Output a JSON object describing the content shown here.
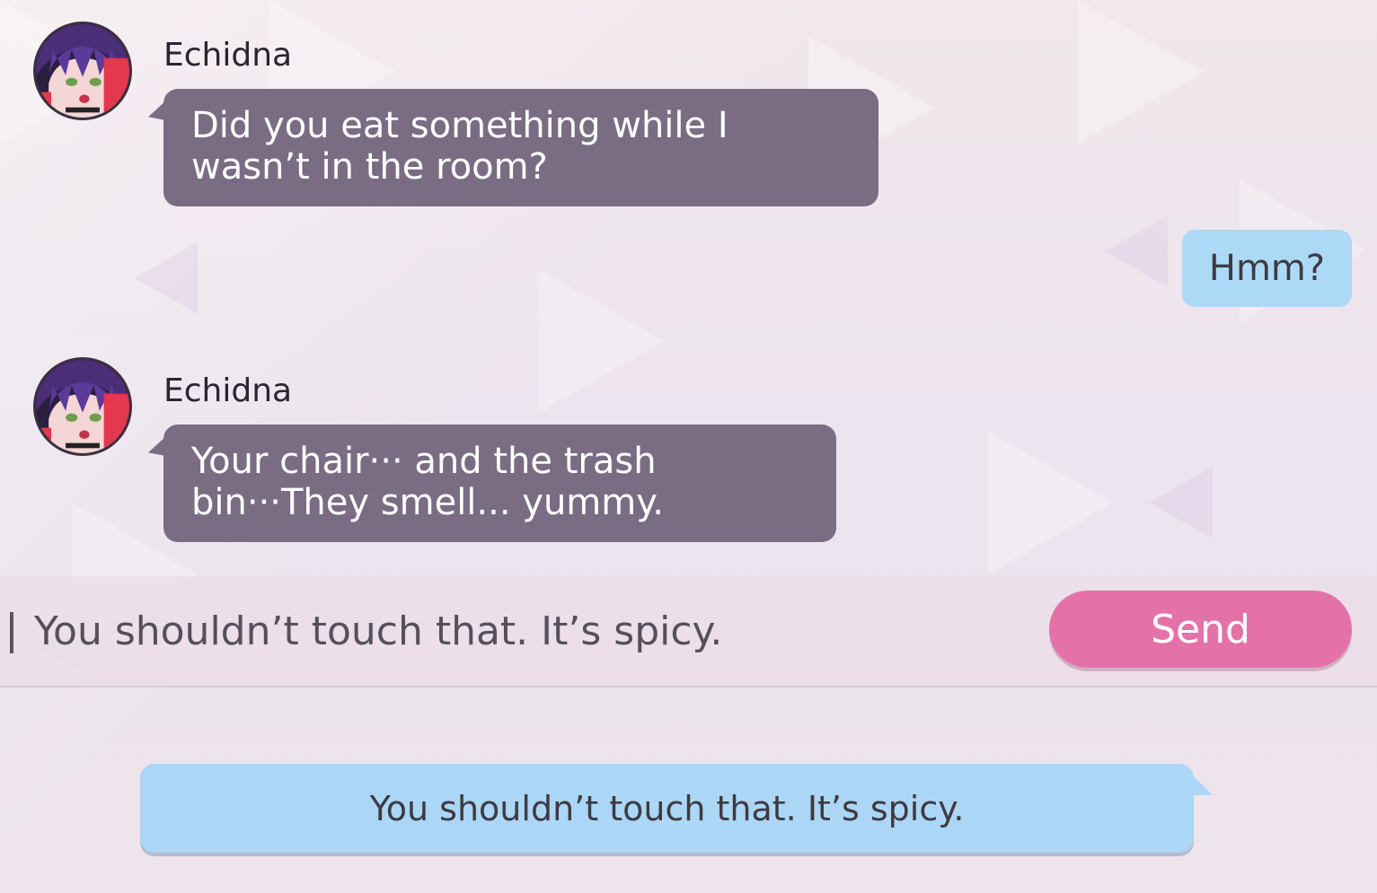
{
  "messages": [
    {
      "sender": "Echidna",
      "text": "Did you eat something while I wasn’t in the room?"
    },
    {
      "sender": "player",
      "text": "Hmm?"
    },
    {
      "sender": "Echidna",
      "text": "Your chair··· and the trash bin···They smell... yummy."
    }
  ],
  "input": {
    "value": "You shouldn’t touch that. It’s spicy."
  },
  "send_button": {
    "label": "Send"
  },
  "preview": {
    "text": "You shouldn’t touch that. It’s spicy."
  },
  "colors": {
    "npc_bubble": "#7a6d83",
    "player_bubble": "#acd9f6",
    "send_button": "#e472a8",
    "background": "#efe6ec"
  },
  "icons": {
    "avatar": "echidna-avatar"
  }
}
